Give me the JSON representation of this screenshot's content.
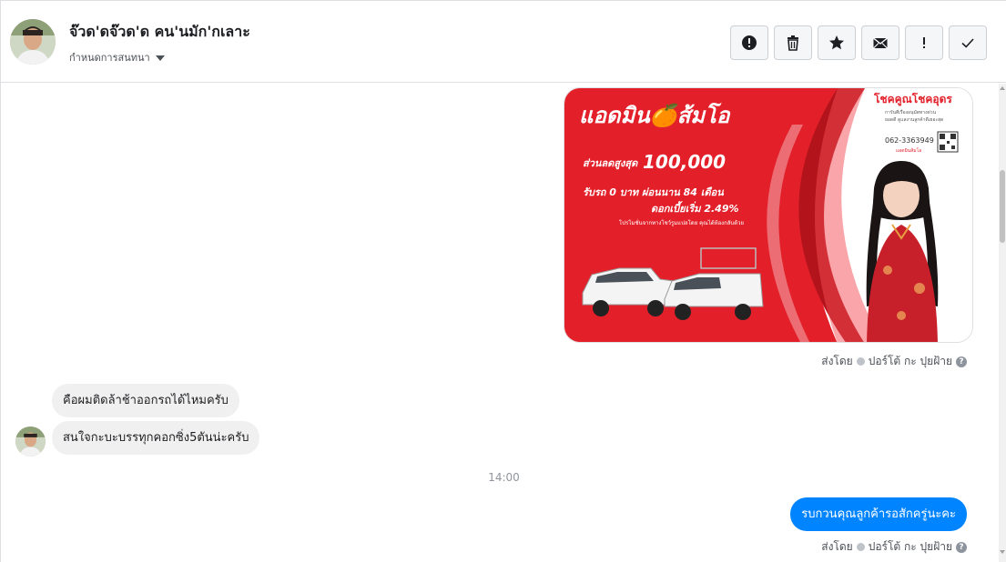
{
  "header": {
    "contact_name": "จ๊วด'ดจ๊วด'ด คน'นมัก'กเลาะ",
    "assign_label": "กำหนดการสนทนา",
    "toolbar": [
      {
        "icon": "alert-circle-icon",
        "name": "report-button"
      },
      {
        "icon": "trash-icon",
        "name": "delete-button"
      },
      {
        "icon": "star-icon",
        "name": "star-button"
      },
      {
        "icon": "envelope-icon",
        "name": "mark-unread-button"
      },
      {
        "icon": "exclamation-icon",
        "name": "spam-button"
      },
      {
        "icon": "checkmark-icon",
        "name": "done-button"
      }
    ]
  },
  "ad_image": {
    "headline": "แอดมิน🍊ส้มโอ",
    "brand": "โชคคูณโชคอุดร",
    "brand_sub1": "การันตีเรื่องอนุมัตทางด่วน",
    "brand_sub2": "ยอดดี ดูแลงานลูกค้าดีเยอะสุด",
    "phone": "062-3363949",
    "qr_caption": "แอดมินส้มโอ",
    "discount_label": "ส่วนลดสูงสุด",
    "discount_value": "100,000",
    "line2": "รับรถ 0 บาท ผ่อนนาน 84 เดือน",
    "line3": "ดอกเบี้ยเริ่ม 2.49%",
    "fine_print": "โปรโมชั่นจากทางโชว์รูมแปลโดย คุณได้ห้องกลับด้วย"
  },
  "sent_by": {
    "prefix": "ส่งโดย",
    "name": "ปอร์โต้ กะ ปุยฝ้าย"
  },
  "messages_in": [
    "คือผมติดล้าช้าออกรถได้ไหมครับ",
    "สนใจกะบะบรรทุกคอกซิ่ง5ตันน่ะครับ"
  ],
  "timestamp": "14:00",
  "message_out": "รบกวนคุณลูกค้ารอสักครู่นะคะ",
  "colors": {
    "accent": "#0084ff",
    "incoming_bubble": "#f1f0f0",
    "ad_red": "#e3202a"
  }
}
